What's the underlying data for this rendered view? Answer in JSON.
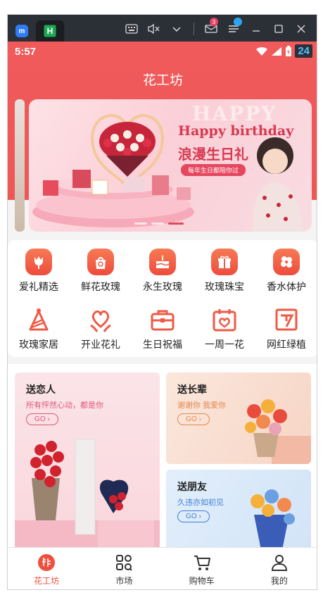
{
  "emulator": {
    "tab_badge": "H",
    "mail_count": "3"
  },
  "status_bar": {
    "time": "5:57",
    "notif_count": "24"
  },
  "header": {
    "title": "花工坊"
  },
  "banner": {
    "title_en": "Happy birthday",
    "title_cn": "浪漫生日礼",
    "pill": "每年生日都陪你过",
    "ghost": "HAPPY"
  },
  "categories": [
    {
      "label": "爱礼精选",
      "icon": "tulip-icon"
    },
    {
      "label": "鲜花玫瑰",
      "icon": "gift-bag-icon"
    },
    {
      "label": "永生玫瑰",
      "icon": "cake-icon"
    },
    {
      "label": "玫瑰珠宝",
      "icon": "gift-box-icon"
    },
    {
      "label": "香水体护",
      "icon": "flower-icon"
    },
    {
      "label": "玫瑰家居",
      "icon": "party-hat-icon"
    },
    {
      "label": "开业花礼",
      "icon": "heart-hands-icon"
    },
    {
      "label": "生日祝福",
      "icon": "briefcase-icon"
    },
    {
      "label": "一周一花",
      "icon": "calendar-heart-icon"
    },
    {
      "label": "网红绿植",
      "icon": "note-icon"
    }
  ],
  "promos": {
    "lover": {
      "title": "送恋人",
      "subtitle": "所有怦然心动，都是你",
      "go": "GO"
    },
    "elder": {
      "title": "送长辈",
      "subtitle": "谢谢你 我爱你",
      "go": "GO"
    },
    "friend": {
      "title": "送朋友",
      "subtitle": "久违亦如初见",
      "go": "GO"
    }
  },
  "nav": [
    {
      "label": "花工坊",
      "icon": "flower-home-icon",
      "active": true
    },
    {
      "label": "市场",
      "icon": "market-grid-icon"
    },
    {
      "label": "购物车",
      "icon": "cart-icon"
    },
    {
      "label": "我的",
      "icon": "user-icon"
    }
  ],
  "colors": {
    "brand": "#ef5757",
    "accent": "#ef4f3c",
    "banner_text": "#d8394f"
  }
}
